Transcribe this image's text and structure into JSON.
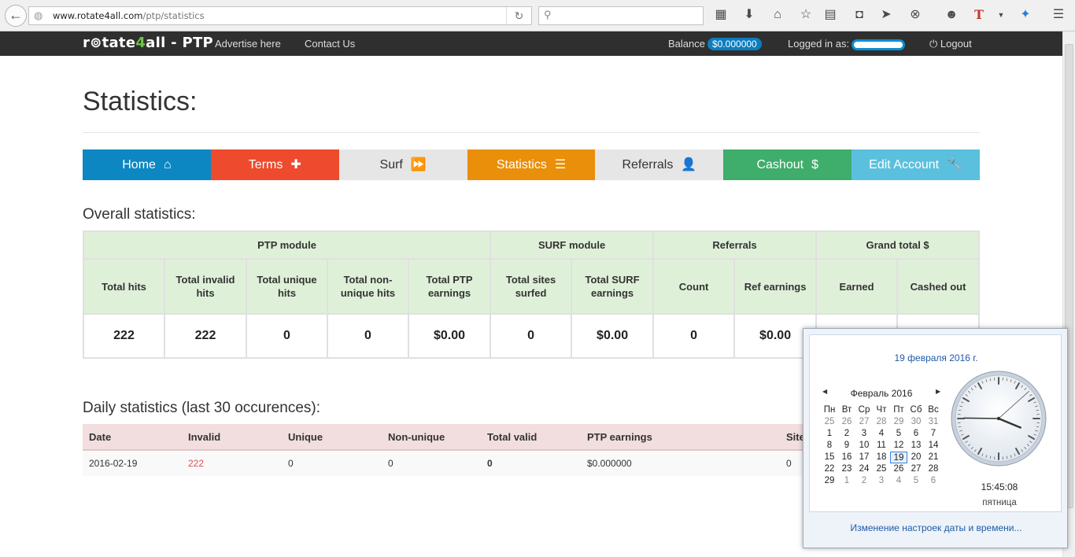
{
  "browser": {
    "url_host": "www.rotate4all.com",
    "url_path": "/ptp/statistics"
  },
  "navbar": {
    "brand_prefix": "r",
    "brand_mid": "tate",
    "brand_num": "4",
    "brand_suffix": "all - PTP",
    "links": [
      "Advertise here",
      "Contact Us"
    ],
    "balance_label": "Balance",
    "balance_value": "$0.000000",
    "logged_label": "Logged in as:",
    "logout_label": "Logout"
  },
  "page": {
    "title": "Statistics:",
    "overall_title": "Overall statistics:",
    "daily_title": "Daily statistics (last 30 occurences):"
  },
  "menu": [
    {
      "label": "Home",
      "icon": "home-icon",
      "glyph": "⌂",
      "bg": "#0d87c1",
      "fg": "#ffffff"
    },
    {
      "label": "Terms",
      "icon": "plus-icon",
      "glyph": "✚",
      "bg": "#ee4a2e",
      "fg": "#ffffff"
    },
    {
      "label": "Surf",
      "icon": "fast-forward-icon",
      "glyph": "⏩",
      "bg": "#e6e6e6",
      "fg": "#333333"
    },
    {
      "label": "Statistics",
      "icon": "list-icon",
      "glyph": "☰",
      "bg": "#ea8f0a",
      "fg": "#ffffff"
    },
    {
      "label": "Referrals",
      "icon": "user-icon",
      "glyph": "👤",
      "bg": "#e6e6e6",
      "fg": "#333333"
    },
    {
      "label": "Cashout",
      "icon": "dollar-icon",
      "glyph": "$",
      "bg": "#3fad6b",
      "fg": "#ffffff"
    },
    {
      "label": "Edit Account",
      "icon": "wrench-icon",
      "glyph": "🔧",
      "bg": "#5bc0de",
      "fg": "#ffffff"
    }
  ],
  "overall": {
    "groups": [
      "PTP module",
      "SURF module",
      "Referrals",
      "Grand total $"
    ],
    "columns": [
      "Total hits",
      "Total invalid hits",
      "Total unique hits",
      "Total non-unique hits",
      "Total PTP earnings",
      "Total sites surfed",
      "Total SURF earnings",
      "Count",
      "Ref earnings",
      "Earned",
      "Cashed out"
    ],
    "values": [
      "222",
      "222",
      "0",
      "0",
      "$0.00",
      "0",
      "$0.00",
      "0",
      "$0.00",
      "",
      ""
    ]
  },
  "daily": {
    "columns": [
      "Date",
      "Invalid",
      "Unique",
      "Non-unique",
      "Total valid",
      "PTP earnings",
      "Site"
    ],
    "rows": [
      [
        "2016-02-19",
        "222",
        "0",
        "0",
        "0",
        "$0.000000",
        "0"
      ]
    ]
  },
  "clock_popup": {
    "date_long": "19 февраля 2016 г.",
    "month_title": "Февраль 2016",
    "weekdays": [
      "Пн",
      "Вт",
      "Ср",
      "Чт",
      "Пт",
      "Сб",
      "Вс"
    ],
    "weeks": [
      [
        "25",
        "26",
        "27",
        "28",
        "29",
        "30",
        "31"
      ],
      [
        "1",
        "2",
        "3",
        "4",
        "5",
        "6",
        "7"
      ],
      [
        "8",
        "9",
        "10",
        "11",
        "12",
        "13",
        "14"
      ],
      [
        "15",
        "16",
        "17",
        "18",
        "19",
        "20",
        "21"
      ],
      [
        "22",
        "23",
        "24",
        "25",
        "26",
        "27",
        "28"
      ],
      [
        "29",
        "1",
        "2",
        "3",
        "4",
        "5",
        "6"
      ]
    ],
    "today": "19",
    "time": "15:45:08",
    "weekday_name": "пятница",
    "settings_link": "Изменение настроек даты и времени..."
  }
}
